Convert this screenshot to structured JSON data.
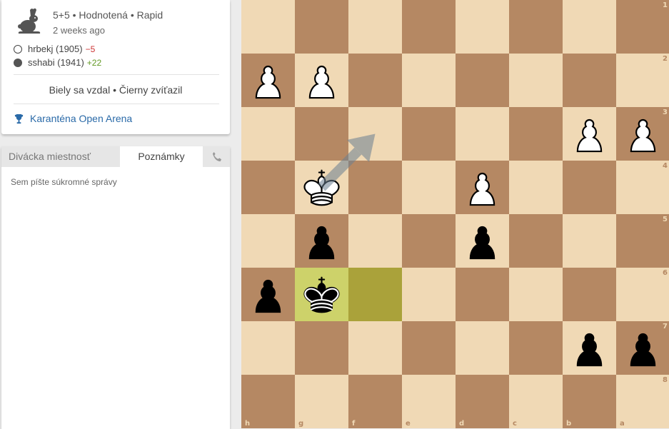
{
  "game": {
    "speed_icon": "rabbit-icon",
    "meta": "5+5 • Hodnotená • Rapid",
    "time_ago": "2 weeks ago",
    "players": [
      {
        "color": "white",
        "name": "hrbekj (1905)",
        "rating_diff": "−5",
        "diff_type": "bad"
      },
      {
        "color": "black",
        "name": "sshabi (1941)",
        "rating_diff": "+22",
        "diff_type": "good"
      }
    ],
    "result": "Biely sa vzdal • Čierny zvíťazil",
    "tournament": {
      "icon": "trophy-icon",
      "name": "Karanténa Open Arena"
    }
  },
  "chat": {
    "tabs": {
      "spectator": "Divácka miestnosť",
      "notes": "Poznámky",
      "phone_icon": "phone-icon"
    },
    "notes_placeholder": "Sem píšte súkromné správy"
  },
  "board": {
    "orientation": "black",
    "files": [
      "h",
      "g",
      "f",
      "e",
      "d",
      "c",
      "b",
      "a"
    ],
    "ranks": [
      "1",
      "2",
      "3",
      "4",
      "5",
      "6",
      "7",
      "8"
    ],
    "pieces": [
      {
        "square": "h2",
        "type": "pawn",
        "color": "white"
      },
      {
        "square": "g2",
        "type": "pawn",
        "color": "white"
      },
      {
        "square": "b3",
        "type": "pawn",
        "color": "white"
      },
      {
        "square": "a3",
        "type": "pawn",
        "color": "white"
      },
      {
        "square": "g4",
        "type": "king",
        "color": "white"
      },
      {
        "square": "d4",
        "type": "pawn",
        "color": "white"
      },
      {
        "square": "g5",
        "type": "pawn",
        "color": "black"
      },
      {
        "square": "d5",
        "type": "pawn",
        "color": "black"
      },
      {
        "square": "h6",
        "type": "pawn",
        "color": "black"
      },
      {
        "square": "g6",
        "type": "king",
        "color": "black"
      },
      {
        "square": "b7",
        "type": "pawn",
        "color": "black"
      },
      {
        "square": "a7",
        "type": "pawn",
        "color": "black"
      }
    ],
    "last_move": {
      "from": "f6",
      "to": "g6"
    },
    "arrow": {
      "from": "g4",
      "to": "f3",
      "color": "#6b7f91"
    },
    "colors": {
      "light": "#f0d9b5",
      "dark": "#b58863",
      "last_from": "#aaa23a",
      "last_to": "#cdd26a"
    }
  }
}
